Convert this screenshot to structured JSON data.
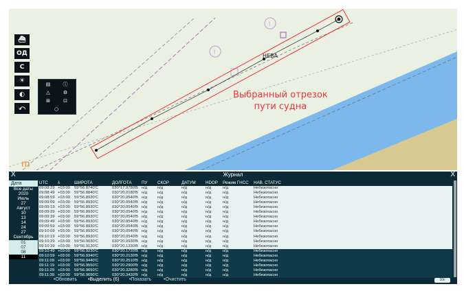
{
  "chart": {
    "annotation_line1": "Выбранный отрезок",
    "annotation_line2": "пути судна",
    "place_label": "НЕВА",
    "bottom_left_mark": "m"
  },
  "toolbar": {
    "buttons": [
      "ship-icon",
      "ОД",
      "С",
      "sun-icon",
      "eye-icon",
      "arrow-icon"
    ],
    "od_label": "ОД",
    "c_label": "С"
  },
  "popup": {
    "items": [
      "list-icon",
      "info-icon",
      "triangle-icon",
      "wrench-icon",
      "measure-icon",
      "lock-icon",
      "circle-icon"
    ]
  },
  "journal": {
    "title": "Журнал",
    "close": "X",
    "columns": [
      "UTC",
      "λ",
      "ШИРОТА",
      "ДОЛГОТА",
      "ПУ",
      "СКОР",
      "ДАТУМ",
      "HDOP",
      "Режим ГНСС",
      "НАВ. СТАТУС"
    ],
    "dates_header": "Дата",
    "dates": [
      "Все даты",
      "2020",
      "Июль",
      "27",
      "Август",
      "10",
      "13",
      "14",
      "24",
      "27",
      "Сентябрь",
      "01",
      "07",
      "08",
      "11"
    ],
    "selected_date_index": 14,
    "rows": [
      [
        "09:08:29",
        "+03:00",
        "59°56.8740'С",
        "030°17.9780'В",
        "н/д",
        "н/д",
        "н/д",
        "н/д",
        "н/д",
        "Небезопасно"
      ],
      [
        "09:08:49",
        "+03:00",
        "59°56.8840'С",
        "030°20.0180'В",
        "н/д",
        "н/д",
        "н/д",
        "н/д",
        "н/д",
        "Небезопасно"
      ],
      [
        "09:08:59",
        "+03:00",
        "59°56.8930'С",
        "030°20.0540'В",
        "н/д",
        "н/д",
        "н/д",
        "н/д",
        "н/д",
        "Небезопасно"
      ],
      [
        "09:09:09",
        "+03:00",
        "59°56.8930'С",
        "030°20.0540'В",
        "н/д",
        "н/д",
        "н/д",
        "н/д",
        "н/д",
        "Небезопасно"
      ],
      [
        "09:09:19",
        "+03:00",
        "59°56.8930'С",
        "030°20.0540'В",
        "н/д",
        "н/д",
        "н/д",
        "н/д",
        "н/д",
        "Небезопасно"
      ],
      [
        "09:09:29",
        "+03:00",
        "59°56.8930'С",
        "030°20.0540'В",
        "н/д",
        "н/д",
        "н/д",
        "н/д",
        "н/д",
        "Небезопасно"
      ],
      [
        "09:09:39",
        "+03:00",
        "59°56.8930'С",
        "030°20.0540'В",
        "н/д",
        "н/д",
        "н/д",
        "н/д",
        "н/д",
        "Небезопасно"
      ],
      [
        "09:09:49",
        "+03:00",
        "59°56.8930'С",
        "030°20.0540'В",
        "н/д",
        "н/д",
        "н/д",
        "н/д",
        "н/д",
        "Небезопасно"
      ],
      [
        "09:09:59",
        "+03:00",
        "59°56.8930'С",
        "030°20.0540'В",
        "н/д",
        "н/д",
        "н/д",
        "н/д",
        "н/д",
        "Небезопасно"
      ],
      [
        "09:10:09",
        "+03:00",
        "59°56.8930'С",
        "030°20.0540'В",
        "н/д",
        "н/д",
        "н/д",
        "н/д",
        "н/д",
        "Небезопасно"
      ],
      [
        "09:10:19",
        "+03:00",
        "59°56.8930'С",
        "030°20.0540'В",
        "н/д",
        "н/д",
        "н/д",
        "н/д",
        "н/д",
        "Небезопасно"
      ],
      [
        "09:10:29",
        "+03:00",
        "59°56.9030'С",
        "030°20.0930'В",
        "н/д",
        "н/д",
        "н/д",
        "н/д",
        "н/д",
        "Небезопасно"
      ],
      [
        "09:10:39",
        "+03:00",
        "59°56.9130'С",
        "030°20.1330'В",
        "н/д",
        "н/д",
        "н/д",
        "н/д",
        "н/д",
        "Небезопасно"
      ],
      [
        "09:10:49",
        "+03:00",
        "59°56.9230'С",
        "030°20.1720'В",
        "н/д",
        "н/д",
        "н/д",
        "н/д",
        "н/д",
        "Небезопасно"
      ],
      [
        "09:10:59",
        "+03:00",
        "59°56.9340'С",
        "030°20.2130'В",
        "н/д",
        "н/д",
        "н/д",
        "н/д",
        "н/д",
        "Небезопасно"
      ],
      [
        "09:11:09",
        "+03:00",
        "59°56.9440'С",
        "030°20.2510'В",
        "н/д",
        "н/д",
        "н/д",
        "н/д",
        "н/д",
        "Небезопасно"
      ],
      [
        "09:11:19",
        "+03:00",
        "59°56.9550'С",
        "030°20.2900'В",
        "н/д",
        "н/д",
        "н/д",
        "н/д",
        "н/д",
        "Небезопасно"
      ],
      [
        "09:11:29",
        "+03:00",
        "59°56.9650'С",
        "030°20.3280'В",
        "н/д",
        "н/д",
        "н/д",
        "н/д",
        "н/д",
        "Небезопасно"
      ],
      [
        "09:11:39",
        "+03:00",
        "59°56.9690'С",
        "030°20.3430'В",
        "н/д",
        "н/д",
        "н/д",
        "н/д",
        "н/д",
        "Небезопасно"
      ]
    ],
    "highlighted_from_row": 13,
    "footer": {
      "refresh": "•Обновить",
      "select": "•Выделить (6)",
      "show": "•Показать",
      "clear": "•Очистить",
      "time_button": "10с"
    }
  },
  "colors": {
    "water": "#7db8ec",
    "land": "#d7c992",
    "chart_bg": "#eaf0e2",
    "route": "#e8373a",
    "panel": "#0c2a36"
  }
}
